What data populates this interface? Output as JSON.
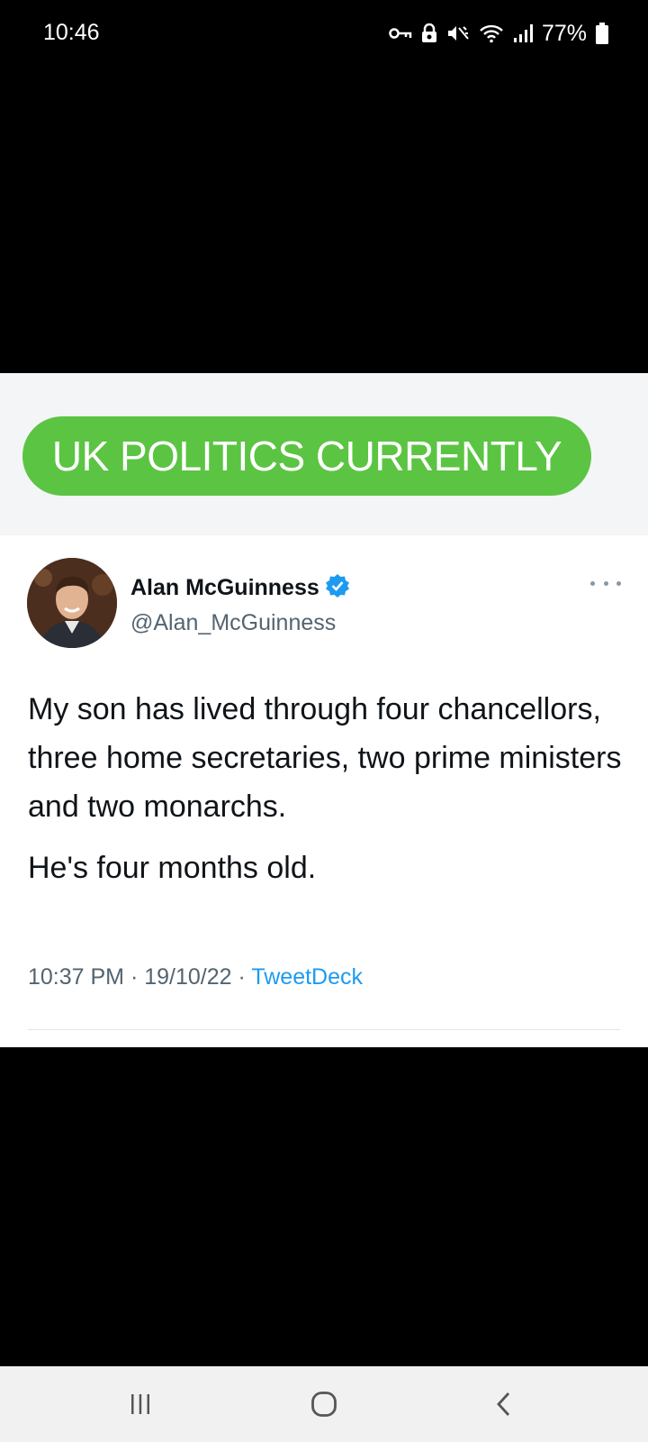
{
  "status_bar": {
    "time": "10:46",
    "battery_percent": "77%",
    "icons": [
      "vpn-key-icon",
      "secure-folder-icon",
      "mute-icon",
      "wifi-icon",
      "signal-icon",
      "battery-icon"
    ]
  },
  "banner": {
    "text": "UK POLITICS CURRENTLY",
    "color": "#5cc443"
  },
  "tweet": {
    "author_name": "Alan McGuinness",
    "author_handle": "@Alan_McGuinness",
    "verified_color": "#1d9bf0",
    "body_paragraph_1": "My son has lived through four chancellors, three home secretaries, two prime ministers and two monarchs.",
    "body_paragraph_2": "He's four months old.",
    "time": "10:37 PM",
    "separator": "·",
    "date": "19/10/22",
    "source": "TweetDeck"
  },
  "nav_bar": {
    "buttons": [
      "recent-apps-icon",
      "home-icon",
      "back-icon"
    ]
  }
}
